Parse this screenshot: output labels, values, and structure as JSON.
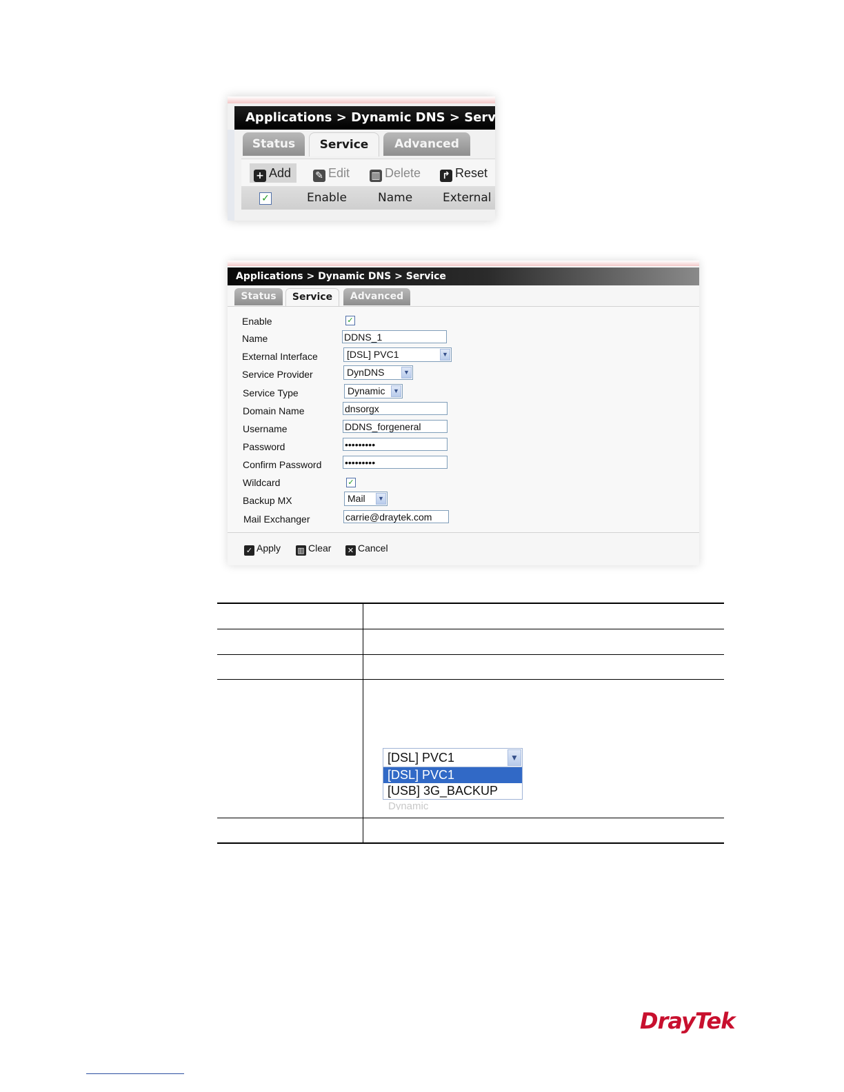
{
  "shot1": {
    "breadcrumb": "Applications > Dynamic DNS > Service",
    "tabs": [
      {
        "label": "Status"
      },
      {
        "label": "Service"
      },
      {
        "label": "Advanced"
      }
    ],
    "toolbar": {
      "add": "Add",
      "edit": "Edit",
      "delete": "Delete",
      "reset": "Reset"
    },
    "columns": [
      "Enable",
      "Name",
      "External"
    ]
  },
  "shot2": {
    "breadcrumb": "Applications > Dynamic DNS > Service",
    "tabs": [
      {
        "label": "Status"
      },
      {
        "label": "Service"
      },
      {
        "label": "Advanced"
      }
    ],
    "labels": {
      "enable": "Enable",
      "name": "Name",
      "external_interface": "External Interface",
      "service_provider": "Service Provider",
      "service_type": "Service Type",
      "domain_name": "Domain Name",
      "username": "Username",
      "password": "Password",
      "confirm_password": "Confirm Password",
      "wildcard": "Wildcard",
      "backup_mx": "Backup MX",
      "mail_exchanger": "Mail Exchanger"
    },
    "values": {
      "enable_checked": true,
      "name": "DDNS_1",
      "external_interface": "[DSL] PVC1",
      "service_provider": "DynDNS",
      "service_type": "Dynamic",
      "domain_name": "dnsorgx",
      "username": "DDNS_forgeneral",
      "password": "•••••••••",
      "confirm_password": "•••••••••",
      "wildcard_checked": true,
      "backup_mx": "Mail",
      "mail_exchanger": "carrie@draytek.com"
    },
    "buttons": {
      "apply": "Apply",
      "clear": "Clear",
      "cancel": "Cancel"
    }
  },
  "dropdown": {
    "selected": "[DSL] PVC1",
    "options": [
      "[DSL] PVC1",
      "[USB] 3G_BACKUP"
    ],
    "ghost": "Dynamic"
  },
  "logo": "DrayTek",
  "colors": {
    "brand_red": "#c8102e",
    "highlight_blue": "#3169c6",
    "check_green": "#1f9a1f"
  }
}
